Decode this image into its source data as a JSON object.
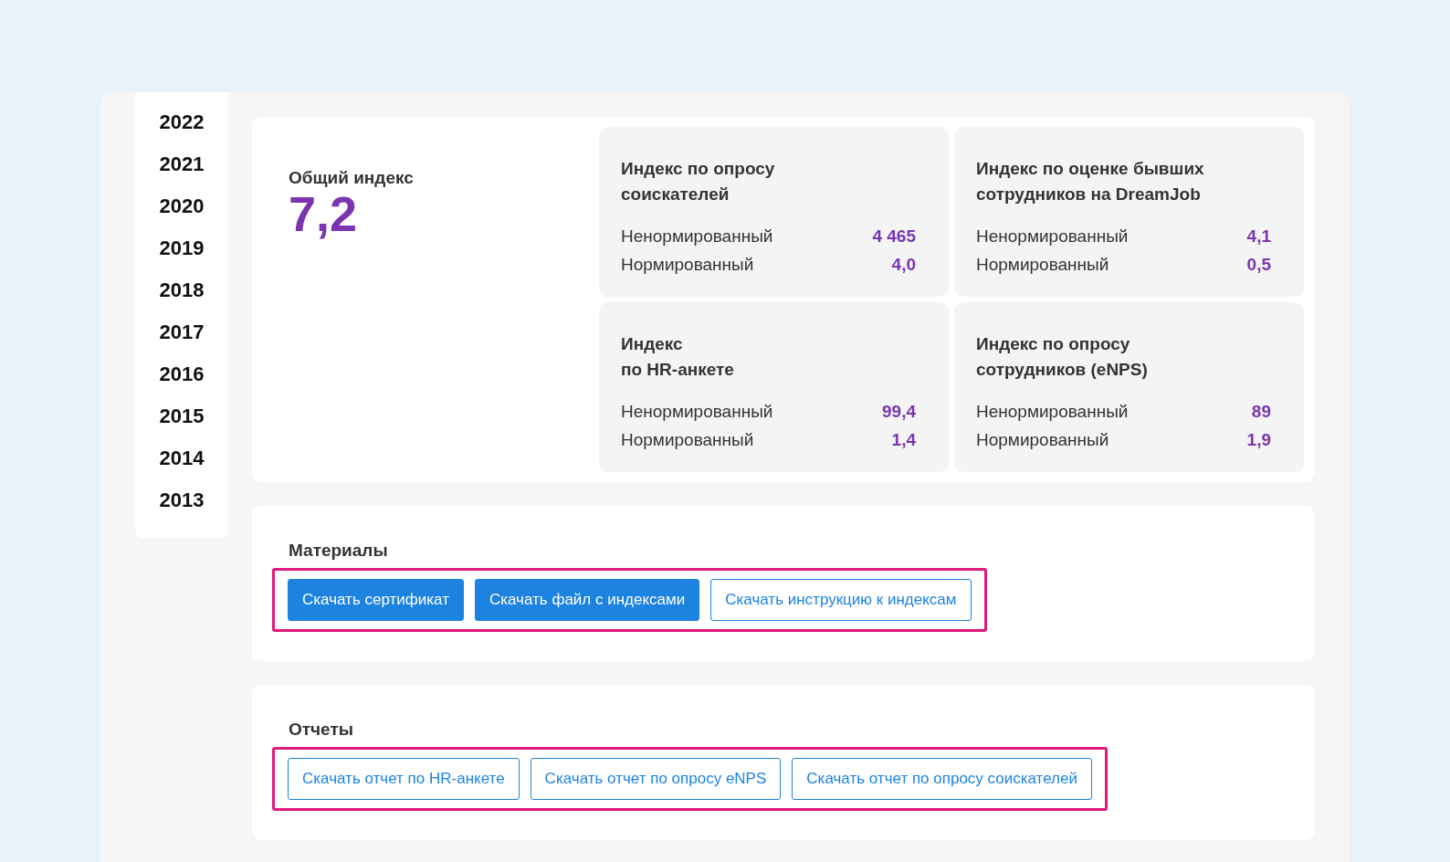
{
  "years": [
    {
      "label": "2022",
      "selected": false
    },
    {
      "label": "2021",
      "selected": false
    },
    {
      "label": "2020",
      "selected": false
    },
    {
      "label": "2019",
      "selected": false
    },
    {
      "label": "2018",
      "selected": false
    },
    {
      "label": "2017",
      "selected": false
    },
    {
      "label": "2016",
      "selected": false
    },
    {
      "label": "2015",
      "selected": false
    },
    {
      "label": "2014",
      "selected": false
    },
    {
      "label": "2013",
      "selected": false
    }
  ],
  "overall": {
    "label": "Общий индекс",
    "value": "7,2"
  },
  "indices": [
    {
      "title": "Индекс по опросу\nсоискателей",
      "rows": [
        {
          "label": "Ненормированный",
          "value": "4 465"
        },
        {
          "label": "Нормированный",
          "value": "4,0"
        }
      ]
    },
    {
      "title": "Индекс по оценке бывших\nсотрудников на DreamJob",
      "rows": [
        {
          "label": "Ненормированный",
          "value": "4,1"
        },
        {
          "label": "Нормированный",
          "value": "0,5"
        }
      ]
    },
    {
      "title": "Индекс\nпо HR-анкете",
      "rows": [
        {
          "label": "Ненормированный",
          "value": "99,4"
        },
        {
          "label": "Нормированный",
          "value": "1,4"
        }
      ]
    },
    {
      "title": "Индекс по опросу\nсотрудников (eNPS)",
      "rows": [
        {
          "label": "Ненормированный",
          "value": "89"
        },
        {
          "label": "Нормированный",
          "value": "1,9"
        }
      ]
    }
  ],
  "sections": [
    {
      "title": "Материалы",
      "buttons": [
        {
          "label": "Скачать сертификат",
          "kind": "primary"
        },
        {
          "label": "Скачать файл с индексами",
          "kind": "primary"
        },
        {
          "label": "Скачать инструкцию к индексам",
          "kind": "outline"
        }
      ]
    },
    {
      "title": "Отчеты",
      "buttons": [
        {
          "label": "Скачать отчет по HR-анкете",
          "kind": "outline"
        },
        {
          "label": "Скачать отчет по опросу eNPS",
          "kind": "outline"
        },
        {
          "label": "Скачать отчет по опросу соискателей",
          "kind": "outline"
        }
      ]
    }
  ]
}
